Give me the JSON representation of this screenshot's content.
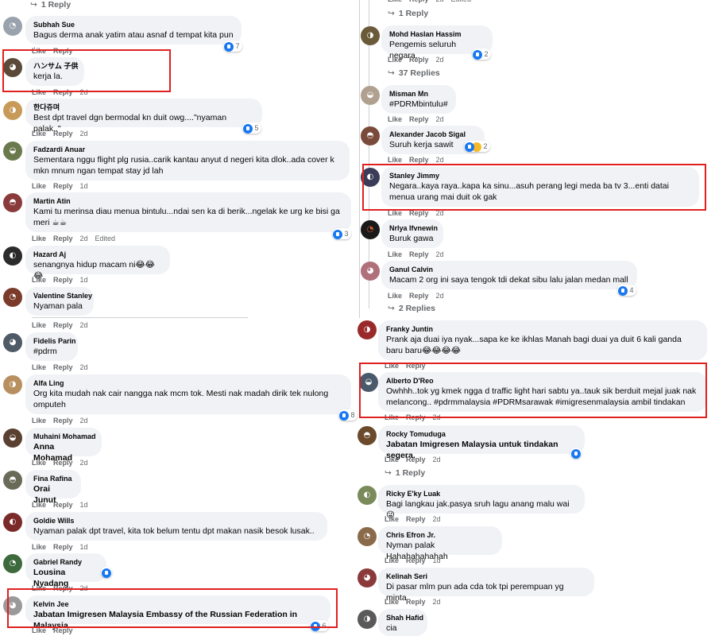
{
  "ui": {
    "like": "Like",
    "reply": "Reply",
    "edited": "Edited"
  },
  "left": {
    "top_replies": "1 Reply",
    "comments": [
      {
        "name": "Subhah Sue",
        "text": "Bagus derma anak yatim atau asnaf d tempat kita pun .",
        "reacts": "7"
      },
      {
        "name": "ハンサム 子供",
        "text": "kerja la.",
        "time": "2d"
      },
      {
        "name": "한다쥬며",
        "text": "Best dpt travel dgn bermodal kn duit owg....\"nyaman palak..\"",
        "time": "2d",
        "reacts": "5"
      },
      {
        "name": "Fadzardi Anuar",
        "text": "Sementara nggu flight plg rusia..carik kantau anyut d negeri kita dlok..ada cover k mkn mnum ngan tempat stay jd lah",
        "time": "1d"
      },
      {
        "name": "Martin Atin",
        "text": "Kami tu merinsa diau menua bintulu...ndai sen ka di berik...ngelak ke urg ke bisi ga meri ☕☕",
        "time": "2d",
        "reacts": "3"
      },
      {
        "name": "Hazard Aj",
        "text": "senangnya hidup macam ni😂😂😂",
        "time": "1d"
      },
      {
        "name": "Valentine Stanley",
        "text": "Nyaman pala",
        "time": "2d"
      },
      {
        "name": "Fidelis Parin",
        "text": "#pdrm",
        "time": "2d"
      },
      {
        "name": "Alfa Ling",
        "text": "Org kita mudah nak cair nangga nak mcm tok. Mesti nak madah dirik tek nulong omputeh",
        "time": "2d",
        "reacts": "8"
      },
      {
        "name": "Muhaini Mohamad",
        "text": "Anna Mohamad",
        "time": "2d"
      },
      {
        "name": "Fina Rafina",
        "text": "Orai Junut",
        "time": "1d"
      },
      {
        "name": "Goldie Wills",
        "text": "Nyaman palak dpt travel, kita tok belum tentu dpt makan nasik besok lusak..",
        "time": "1d"
      },
      {
        "name": "Gabriel Randy",
        "text": "Lousina Nyadang",
        "time": "2d"
      },
      {
        "name": "Kelvin Jee",
        "text": "Jabatan Imigresen Malaysia Embassy of the Russian Federation in Malaysia",
        "reacts": "6"
      }
    ]
  },
  "right": {
    "top_replies": "1 Reply",
    "top_time": "2d",
    "comments": [
      {
        "name": "Mohd Haslan Hassim",
        "text": "Pengemis seluruh negara..",
        "time": "2d",
        "reacts": "2",
        "replies": "37 Replies"
      },
      {
        "name": "Misman Mn",
        "text": "#PDRMbintulu#",
        "time": "2d"
      },
      {
        "name": "Alexander Jacob Sigal",
        "text": "Suruh kerja sawit",
        "time": "2d",
        "reacts": "2"
      },
      {
        "name": "Stanley Jimmy",
        "text": "Negara..kaya raya..kapa ka sinu...asuh perang legi meda ba tv 3...enti datai menua urang mai duit ok gak",
        "time": "2d"
      },
      {
        "name": "Nrlya Ifvnewin",
        "text": "Buruk gawa",
        "time": "2d"
      },
      {
        "name": "Ganul Calvin",
        "text": "Macam 2 org ini saya tengok tdi dekat sibu lalu jalan medan mall",
        "time": "2d",
        "reacts": "4",
        "replies": "2 Replies"
      },
      {
        "name": "Franky Juntin",
        "text": "Prank aja duai iya nyak...sapa ke ke ikhlas Manah bagi duai ya duit 6 kali ganda baru baru😂😂😂😂"
      },
      {
        "name": "Alberto D'Reo",
        "text": "Owhhh..tok yg kmek ngga d traffic light hari sabtu ya..tauk sik berduit mejal juak nak melancong.. #pdrmmalaysia #PDRMsarawak #imigresenmalaysia ambil tindakan",
        "time": "2d"
      },
      {
        "name": "Rocky Tomuduga",
        "text": "Jabatan Imigresen Malaysia untuk tindakan segera.",
        "time": "2d",
        "replies": "1 Reply"
      },
      {
        "name": "Ricky E'ky Luak",
        "text": "Bagi langkau jak.pasya sruh lagu anang malu wai😜",
        "time": "2d"
      },
      {
        "name": "Chris Efron Jr.",
        "text": "Nyman palak Hahahahahahah",
        "time": "1d"
      },
      {
        "name": "Kelinah Seri",
        "text": "Di pasar mlm pun ada cda tok tpi perempuan yg minta",
        "time": "2d"
      },
      {
        "name": "Shah Hafid",
        "text": "cia"
      }
    ]
  },
  "colors": {
    "highlight": "#e0201f",
    "bubble": "#f0f2f5",
    "like": "#1877f2",
    "meta": "#65676b"
  }
}
